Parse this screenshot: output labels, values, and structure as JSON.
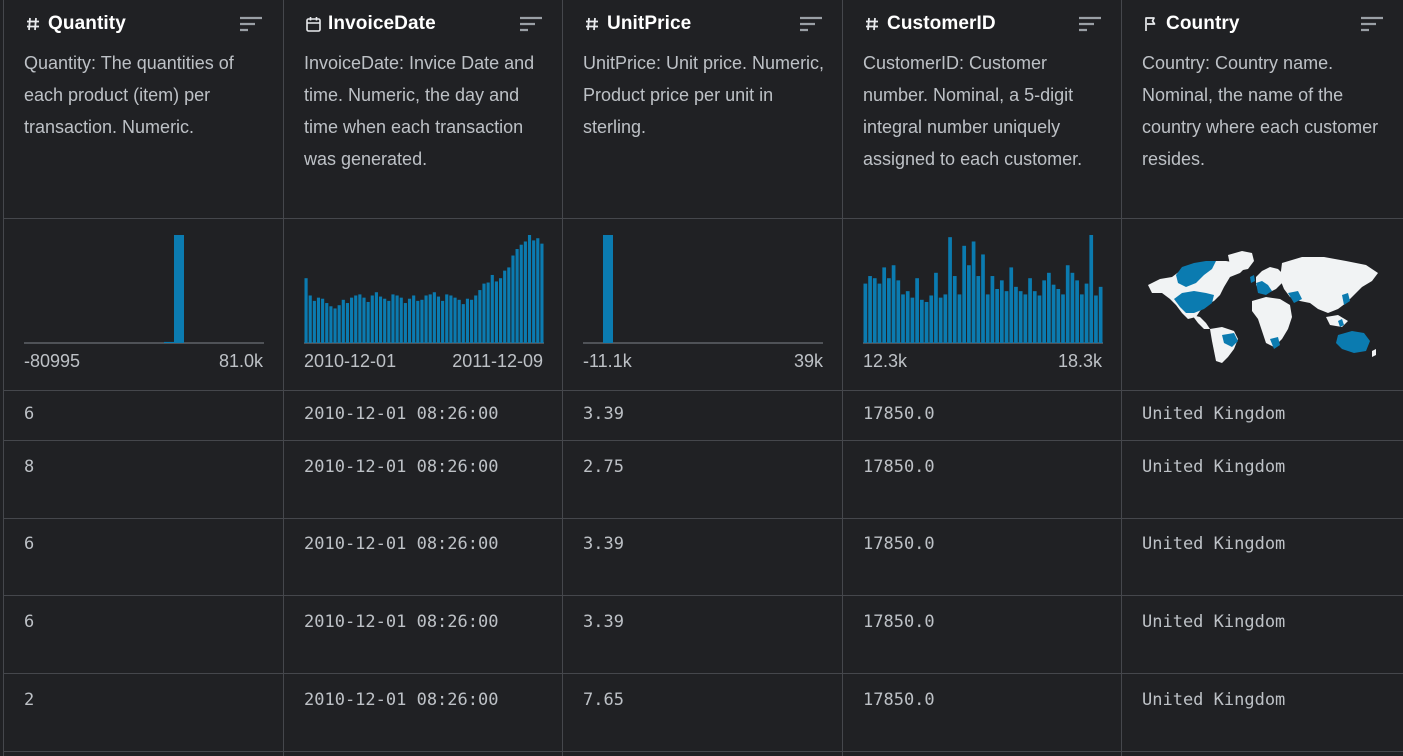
{
  "colors": {
    "bg": "#202124",
    "bar": "#0b7bb0",
    "border": "#45474c",
    "text": "#bdc1c6"
  },
  "columns": [
    {
      "key": "quantity",
      "icon": "hash-icon",
      "title": "Quantity",
      "description": "Quantity: The quantities of each product (item) per transaction. Numeric.",
      "range_min": "-80995",
      "range_max": "81.0k",
      "rows": [
        "6",
        "8",
        "6",
        "6",
        "2"
      ]
    },
    {
      "key": "invoicedate",
      "icon": "calendar-icon",
      "title": "InvoiceDate",
      "description": "InvoiceDate: Invice Date and time. Numeric, the day and time when each transaction was generated.",
      "range_min": "2010-12-01",
      "range_max": "2011-12-09",
      "rows": [
        "2010-12-01 08:26:00",
        "2010-12-01 08:26:00",
        "2010-12-01 08:26:00",
        "2010-12-01 08:26:00",
        "2010-12-01 08:26:00"
      ]
    },
    {
      "key": "unitprice",
      "icon": "hash-icon",
      "title": "UnitPrice",
      "description": "UnitPrice: Unit price. Numeric, Product price per unit in sterling.",
      "range_min": "-11.1k",
      "range_max": "39k",
      "rows": [
        "3.39",
        "2.75",
        "3.39",
        "3.39",
        "7.65"
      ]
    },
    {
      "key": "customerid",
      "icon": "hash-icon",
      "title": "CustomerID",
      "description": "CustomerID: Customer number. Nominal, a 5-digit integral number uniquely assigned to each customer.",
      "range_min": "12.3k",
      "range_max": "18.3k",
      "rows": [
        "17850.0",
        "17850.0",
        "17850.0",
        "17850.0",
        "17850.0"
      ]
    },
    {
      "key": "country",
      "icon": "flag-icon",
      "title": "Country",
      "description": "Country: Country name. Nominal, the name of the country where each customer resides.",
      "rows": [
        "United Kingdom",
        "United Kingdom",
        "United Kingdom",
        "United Kingdom",
        "United Kingdom"
      ]
    }
  ],
  "histograms": {
    "quantity": [
      0,
      0,
      0,
      0,
      0,
      0,
      0,
      0,
      0,
      0,
      0,
      0,
      0,
      0,
      1,
      100,
      0,
      0,
      0,
      0,
      0,
      0,
      0,
      0
    ],
    "invoicedate": [
      60,
      44,
      39,
      42,
      41,
      37,
      34,
      32,
      35,
      40,
      37,
      42,
      44,
      45,
      42,
      38,
      44,
      47,
      43,
      41,
      39,
      45,
      44,
      42,
      37,
      41,
      44,
      39,
      40,
      44,
      45,
      47,
      43,
      39,
      45,
      44,
      42,
      40,
      36,
      41,
      40,
      44,
      49,
      55,
      56,
      63,
      57,
      60,
      67,
      70,
      81,
      87,
      91,
      94,
      100,
      95,
      97,
      92
    ],
    "unitprice": [
      0,
      0,
      100,
      0,
      0,
      0,
      0,
      0,
      0,
      0,
      0,
      0,
      0,
      0,
      0,
      0,
      0,
      0,
      0,
      0,
      0,
      0,
      0,
      0
    ],
    "customerid": [
      55,
      62,
      60,
      55,
      70,
      60,
      72,
      58,
      45,
      48,
      42,
      60,
      40,
      38,
      44,
      65,
      42,
      45,
      98,
      62,
      45,
      90,
      72,
      94,
      62,
      82,
      45,
      62,
      50,
      58,
      48,
      70,
      52,
      48,
      45,
      60,
      48,
      44,
      58,
      65,
      54,
      50,
      45,
      72,
      65,
      58,
      45,
      55,
      100,
      44,
      52
    ]
  }
}
